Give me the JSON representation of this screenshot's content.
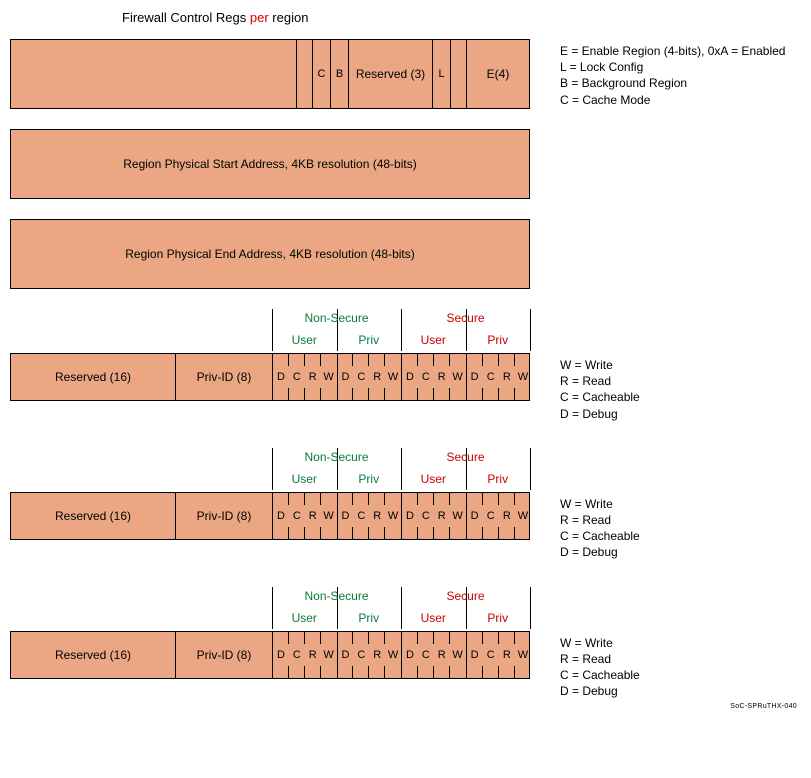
{
  "title_prefix": "Firewall Control Regs ",
  "title_per": "per",
  "title_suffix": " region",
  "box1": {
    "c": "C",
    "b": "B",
    "reserved": "Reserved (3)",
    "l": "L",
    "e": "E(4)"
  },
  "legend1": {
    "e": "E = Enable Region (4-bits), 0xA = Enabled",
    "l": "L = Lock Config",
    "b": "B = Background Region",
    "c": "C = Cache Mode"
  },
  "box2_text": "Region Physical Start Address, 4KB resolution (48-bits)",
  "box3_text": "Region Physical End Address, 4KB resolution (48-bits)",
  "perm_header": {
    "nonsecure": "Non-Secure",
    "secure": "Secure",
    "user": "User",
    "priv": "Priv"
  },
  "perm_reg": {
    "reserved": "Reserved (16)",
    "privid": "Priv-ID (8)",
    "bits": [
      "D",
      "C",
      "R",
      "W"
    ]
  },
  "legend_perm": {
    "w": "W = Write",
    "r": "R = Read",
    "c": "C = Cacheable",
    "d": "D = Debug"
  },
  "footer_id": "SoC-SPRuTHX-040"
}
